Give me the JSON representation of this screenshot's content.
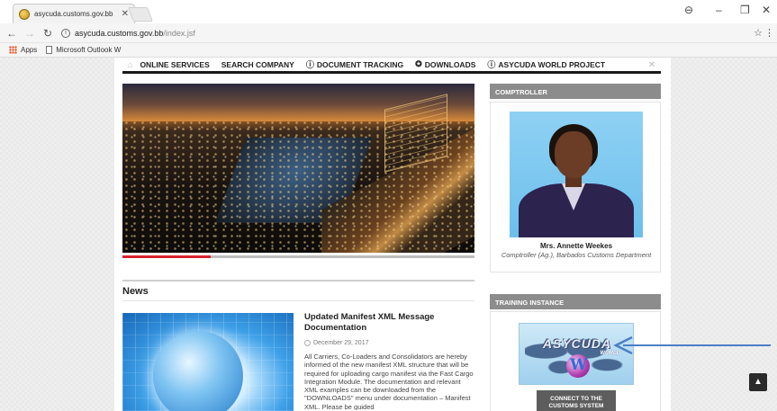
{
  "browser": {
    "tab_title": "asycuda.customs.gov.bb",
    "url_host": "asycuda.customs.gov.bb",
    "url_path": "/index.jsf",
    "bookmarks": [
      {
        "label": "Apps"
      },
      {
        "label": "Microsoft Outlook W"
      }
    ]
  },
  "nav": {
    "items": [
      {
        "label": "ONLINE SERVICES",
        "icon": ""
      },
      {
        "label": "SEARCH COMPANY",
        "icon": ""
      },
      {
        "label": "DOCUMENT TRACKING",
        "icon": "ⓘ"
      },
      {
        "label": "DOWNLOADS",
        "icon": "✪"
      },
      {
        "label": "ASYCUDA WORLD PROJECT",
        "icon": "ⓘ"
      }
    ]
  },
  "news": {
    "heading": "News",
    "article": {
      "title": "Updated Manifest XML Message Documentation",
      "date": "December 29, 2017",
      "body": "All Carriers, Co-Loaders and Consolidators are hereby informed of the new manifest XML structure that will be required for uploading cargo manifest via the Fast Cargo Integration Module. The documentation and relevant XML examples can be downloaded from the \"DOWNLOADS\" menu under documentation – Manifest XML. Please be guided"
    }
  },
  "comptroller": {
    "heading": "COMPTROLLER",
    "name": "Mrs. Annette Weekes",
    "role": "Comptroller (Ag.), Barbados Customs Department"
  },
  "training": {
    "heading": "TRAINING INSTANCE",
    "logo_word": "ASYCUDA",
    "logo_sub": "WORLD",
    "logo_letter": "W",
    "connect_label": "CONNECT TO THE CUSTOMS SYSTEM"
  },
  "colors": {
    "accent_red": "#d9232d",
    "sidebar_header": "#8c8c8c",
    "arrow_blue": "#4a7fc7"
  }
}
